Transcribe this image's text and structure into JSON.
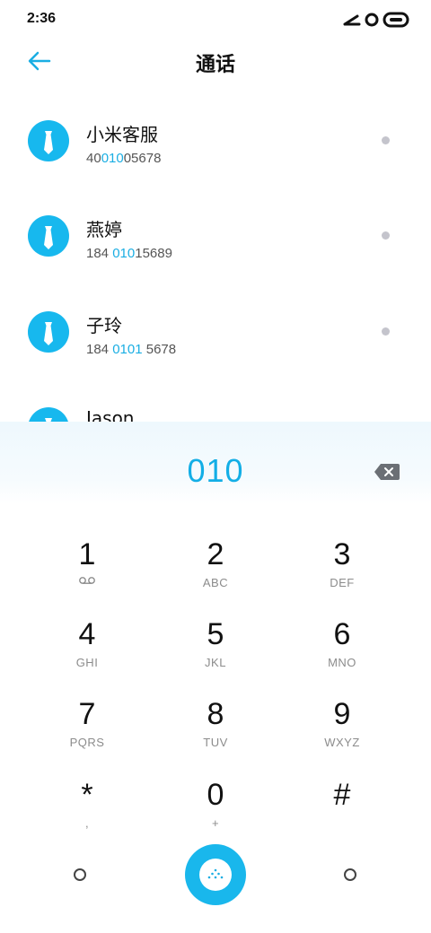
{
  "status_bar": {
    "time": "2:36"
  },
  "header": {
    "title": "通话"
  },
  "contacts": [
    {
      "name": "小米客服",
      "number_parts": [
        "40",
        "010",
        "05678"
      ]
    },
    {
      "name": "燕婷",
      "number_parts": [
        "184 ",
        "010",
        "15689"
      ]
    },
    {
      "name": "子玲",
      "number_parts": [
        "184 ",
        "0101",
        " 5678"
      ]
    },
    {
      "name": "Jason",
      "number_parts": [
        "",
        "",
        ""
      ]
    }
  ],
  "dialer": {
    "input": "010",
    "keys": [
      {
        "digit": "1",
        "letters": ""
      },
      {
        "digit": "2",
        "letters": "ABC"
      },
      {
        "digit": "3",
        "letters": "DEF"
      },
      {
        "digit": "4",
        "letters": "GHI"
      },
      {
        "digit": "5",
        "letters": "JKL"
      },
      {
        "digit": "6",
        "letters": "MNO"
      },
      {
        "digit": "7",
        "letters": "PQRS"
      },
      {
        "digit": "8",
        "letters": "TUV"
      },
      {
        "digit": "9",
        "letters": "WXYZ"
      },
      {
        "digit": "*",
        "letters": ","
      },
      {
        "digit": "0",
        "letters": "+"
      },
      {
        "digit": "#",
        "letters": ""
      }
    ]
  },
  "colors": {
    "accent": "#19b7ec",
    "highlight": "#1aaee3",
    "avatar": "#17b8ee"
  },
  "icons": [
    "back-arrow-icon",
    "contact-avatar-icon",
    "voicemail-icon",
    "backspace-icon",
    "dialpad-icon"
  ]
}
